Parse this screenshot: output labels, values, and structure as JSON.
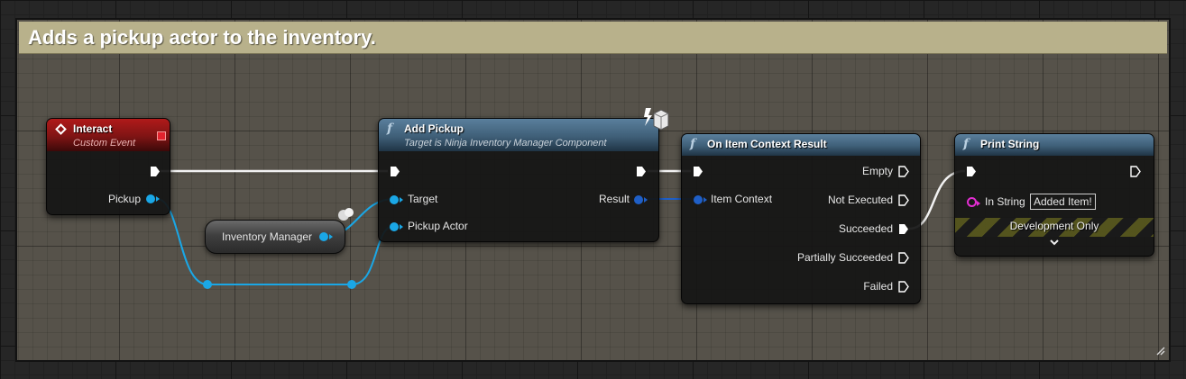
{
  "comment": {
    "title": "Adds a pickup actor to the inventory."
  },
  "nodes": {
    "interact": {
      "title": "Interact",
      "subtitle": "Custom Event",
      "pins": {
        "pickup": "Pickup"
      }
    },
    "inventory_manager": {
      "label": "Inventory Manager"
    },
    "add_pickup": {
      "title": "Add Pickup",
      "subtitle": "Target is Ninja Inventory Manager Component",
      "pins": {
        "target": "Target",
        "pickup_actor": "Pickup Actor",
        "result": "Result"
      }
    },
    "on_item_context_result": {
      "title": "On Item Context Result",
      "pins": {
        "item_context": "Item Context",
        "empty": "Empty",
        "not_executed": "Not Executed",
        "succeeded": "Succeeded",
        "partially_succeeded": "Partially Succeeded",
        "failed": "Failed"
      }
    },
    "print_string": {
      "title": "Print String",
      "pins": {
        "in_string": "In String"
      },
      "in_string_value": "Added Item!",
      "dev_only": "Development Only"
    }
  },
  "icons": [
    "function-icon",
    "event-icon",
    "latent-icon",
    "globe-icon",
    "expand-arrow-icon",
    "resize-grip-icon"
  ],
  "colors": {
    "exec_wire": "#ffffff",
    "object_pin": "#1aa7e6",
    "struct_pin": "#1f5fc7",
    "string_pin": "#e22ed1",
    "event_header": "#a01818",
    "function_header": "#4d6f89",
    "comment_title_bar": "#b8b18b"
  }
}
